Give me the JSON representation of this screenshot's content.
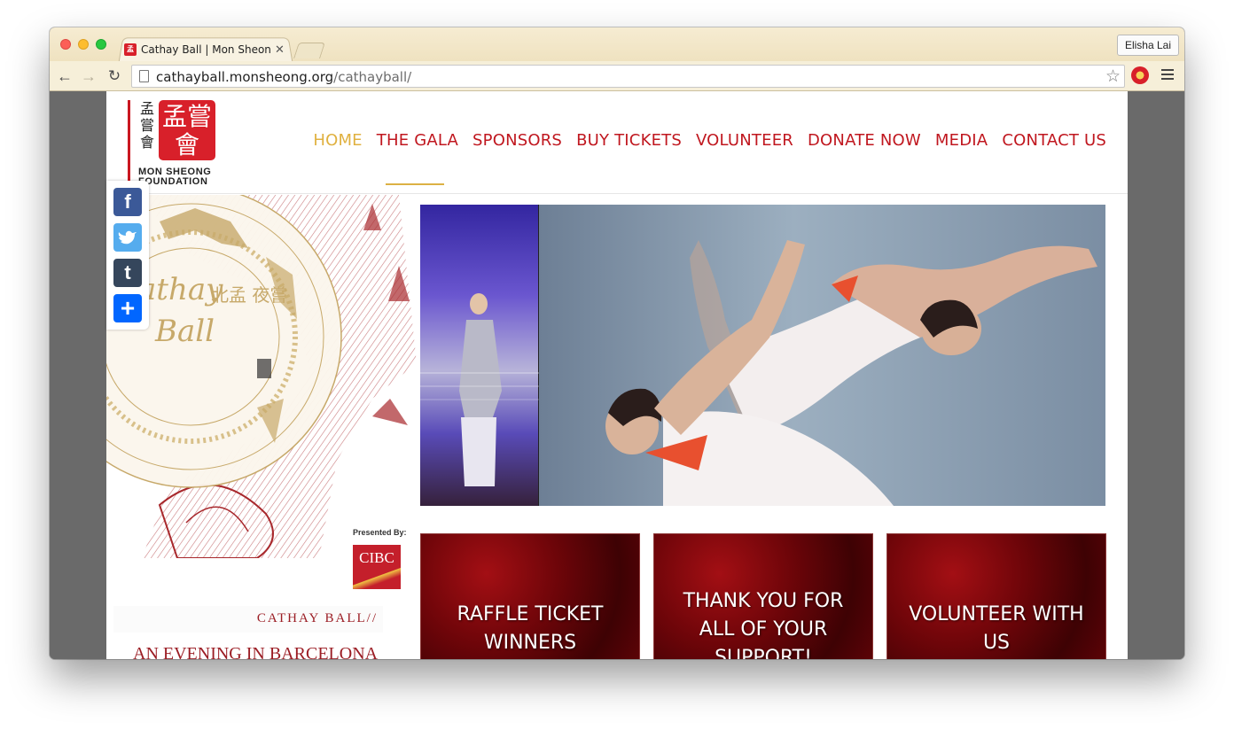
{
  "browser": {
    "tab_title": "Cathay Ball | Mon Sheong F",
    "profile_name": "Elisha Lai",
    "url_host": "cathayball.monsheong.org",
    "url_path": "/cathayball/"
  },
  "header": {
    "logo_chars": [
      "孟",
      "嘗",
      "會"
    ],
    "logo_seal": "孟嘗會",
    "logo_text_line1": "MON SHEONG",
    "logo_text_line2": "FOUNDATION",
    "nav": [
      {
        "label": "HOME",
        "active": true
      },
      {
        "label": "THE GALA",
        "active": false
      },
      {
        "label": "SPONSORS",
        "active": false
      },
      {
        "label": "BUY TICKETS",
        "active": false
      },
      {
        "label": "VOLUNTEER",
        "active": false
      },
      {
        "label": "DONATE NOW",
        "active": false
      },
      {
        "label": "MEDIA",
        "active": false
      },
      {
        "label": "CONTACT US",
        "active": false
      }
    ]
  },
  "share": {
    "buttons": [
      "f",
      "t",
      "t",
      "+"
    ]
  },
  "sidebar": {
    "logo_script_1": "Cathay",
    "logo_script_2": "Ball",
    "logo_chinese": "北孟 夜嘗",
    "presented_by": "Presented By:",
    "sponsor_name": "CIBC",
    "cathay_label": "CATHAY BALL//",
    "evening_title": "AN EVENING IN BARCELONA"
  },
  "tiles": [
    {
      "label": "RAFFLE TICKET WINNERS"
    },
    {
      "label": "THANK YOU FOR ALL OF YOUR SUPPORT!"
    },
    {
      "label": "VOLUNTEER WITH US"
    }
  ],
  "colors": {
    "brand_red": "#c0171f",
    "active_gold": "#e0b140",
    "art_red": "#a8282c",
    "art_gold": "#c7a96a"
  }
}
